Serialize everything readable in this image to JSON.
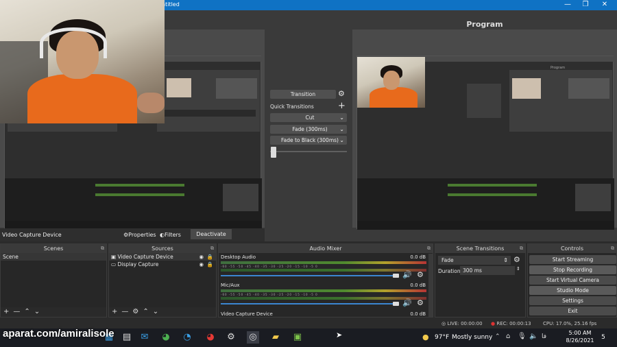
{
  "titlebar": {
    "title": "ntitled"
  },
  "program": {
    "label": "Program"
  },
  "preview_inner": {
    "program_label": "Program"
  },
  "transition_panel": {
    "transition_label": "Transition",
    "quick_transitions_label": "Quick Transitions",
    "cut_label": "Cut",
    "fade_label": "Fade (300ms)",
    "fade_black_label": "Fade to Black (300ms)"
  },
  "preview_toolbar": {
    "source_name": "Video Capture Device",
    "properties": "Properties",
    "filters": "Filters",
    "deactivate": "Deactivate"
  },
  "scenes": {
    "title": "Scenes",
    "items": [
      "Scene"
    ]
  },
  "sources": {
    "title": "Sources",
    "items": [
      "Video Capture Device",
      "Display Capture"
    ]
  },
  "audio_mixer": {
    "title": "Audio Mixer",
    "channels": [
      {
        "name": "Desktop Audio",
        "db": "0.0 dB"
      },
      {
        "name": "Mic/Aux",
        "db": "0.0 dB"
      },
      {
        "name": "Video Capture Device",
        "db": "0.0 dB"
      }
    ],
    "tick_labels": "-60  -55  -50  -45  -40  -35  -30  -25  -20  -15  -10  -5  0"
  },
  "scene_transitions": {
    "title": "Scene Transitions",
    "selected": "Fade",
    "duration_label": "Duration",
    "duration_value": "300 ms"
  },
  "controls": {
    "title": "Controls",
    "buttons": [
      "Start Streaming",
      "Stop Recording",
      "Start Virtual Camera",
      "Studio Mode",
      "Settings",
      "Exit"
    ]
  },
  "status": {
    "live": "LIVE: 00:00:00",
    "rec": "REC: 00:00:13",
    "cpu": "CPU: 17.0%, 25.16 fps"
  },
  "taskbar": {
    "weather_temp": "97°F",
    "weather_text": "Mostly sunny",
    "lang": "فا",
    "time": "5:00 AM",
    "date": "8/26/2021",
    "notif_count": "5"
  },
  "watermark": "aparat.com/amiralisole",
  "colors": {
    "titlebar": "#0f72c4",
    "rec_dot": "#d33",
    "slider": "#3b86d1"
  }
}
